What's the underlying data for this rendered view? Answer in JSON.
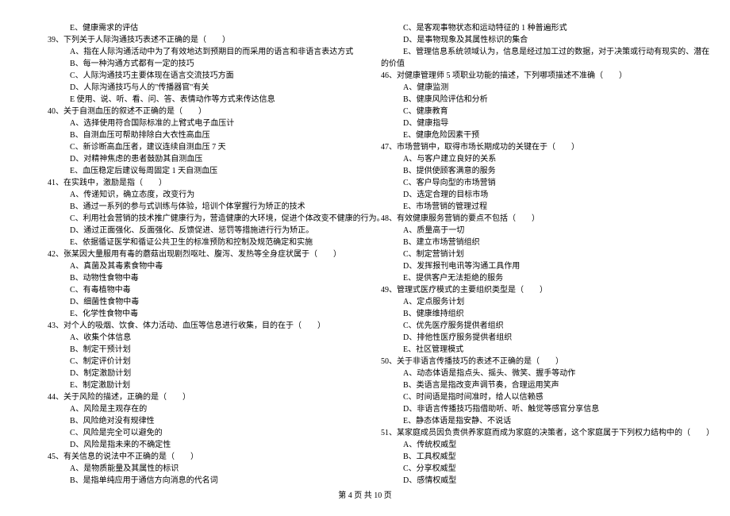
{
  "footer": "第 4 页 共 10 页",
  "left": {
    "pre_opt": "E、健康需求的评估",
    "q39": {
      "stem": "39、下列关于人际沟通技巧表述不正确的是（　　）",
      "A": "A、指在人际沟通活动中为了有效地达到预期目的而采用的语言和非语言表达方式",
      "B": "B、每一种沟通方式都有一定的技巧",
      "C": "C、人际沟通技巧主要体现在语言交流技巧方面",
      "D": "D、人际沟通技巧与人的\"传播器官\"有关",
      "E": "E 使用、说、听、看、问、答、表情动作等方式来传达信息"
    },
    "q40": {
      "stem": "40、关于自测血压的叙述不正确的是（　　）",
      "A": "A、选择使用符合国际标准的上臂式电子血压计",
      "B": "B、自测血压可帮助排除白大衣性高血压",
      "C": "C、新诊断高血压者，建议连续自测血压 7 天",
      "D": "D、对精神焦虑的患者鼓励其自测血压",
      "E": "E、血压稳定后建议每周固定 1 天自测血压"
    },
    "q41": {
      "stem": "41、在实践中，激励是指（　　）",
      "A": "A、传递知识，确立态度，改变行为",
      "B": "B、通过一系列的参与式训练与体验，培训个体掌握行为矫正的技术",
      "C": "C、利用社会营销的技术推广健康行为，营造健康的大环境，促进个体改变不健康的行为。",
      "D": "D、通过正面强化、反面强化、反馈促进、惩罚等措施进行行为矫正。",
      "E": "E、依据循证医学和循证公共卫生的标准预防和控制及规范确定和实施"
    },
    "q42": {
      "stem": "42、张某因大量服用有毒的蘑菇出现剧烈呕吐、腹泻、发热等全身症状属于（　　）",
      "A": "A、真菌及其毒素食物中毒",
      "B": "B、动物性食物中毒",
      "C": "C、有毒植物中毒",
      "D": "D、细菌性食物中毒",
      "E": "E、化学性食物中毒"
    },
    "q43": {
      "stem": "43、对个人的吸烟、饮食、体力活动、血压等信息进行收集，目的在于（　　）",
      "A": "A、收集个体信息",
      "B": "B、制定干预计划",
      "C": "C、制定评价计划",
      "D": "D、制定激励计划",
      "E": "E、制定激励计划"
    },
    "q44": {
      "stem": "44、关于风险的描述，正确的是（　　）",
      "A": "A、风险是主观存在的",
      "B": "B、风险绝对没有规律性",
      "C": "C、风险是完全可以避免的",
      "D": "D、风险是指未来的不确定性"
    },
    "q45": {
      "stem": "45、有关信息的说法中不正确的是（　　）",
      "A": "A、是物质能量及其属性的标识",
      "B": "B、是指单纯应用于通信方向消息的代名词"
    }
  },
  "right": {
    "q45cont": {
      "C": "C、是客观事物状态和运动特征的 1 种普遍形式",
      "D": "D、是事物现象及其属性标识的集合",
      "E": "E、管理信息系统领域认为，信息是经过加工过的数据，对于决策或行动有现实的、潜在",
      "Econt": "的价值"
    },
    "q46": {
      "stem": "46、对健康管理师 5 项职业功能的描述，下列哪项描述不准确（　　）",
      "A": "A、健康监测",
      "B": "B、健康风险评估和分析",
      "C": "C、健康教育",
      "D": "D、健康指导",
      "E": "E、健康危险因素干预"
    },
    "q47": {
      "stem": "47、市场营销中，取得市场长期成功的关键在于（　　）",
      "A": "A、与客户建立良好的关系",
      "B": "B、提供使顾客满意的服务",
      "C": "C、客户导向型的市场营销",
      "D": "D、选定合理的目标市场",
      "E": "E、市场营销的管理过程"
    },
    "q48": {
      "stem": "48、有效健康服务营销的要点不包括（　　）",
      "A": "A、质量高于一切",
      "B": "B、建立市场营销组织",
      "C": "C、制定营销计划",
      "D": "D、发挥报刊电讯等沟通工具作用",
      "E": "E、提供客户无法拒绝的服务"
    },
    "q49": {
      "stem": "49、管理式医疗模式的主要组织类型是（　　）",
      "A": "A、定点服务计划",
      "B": "B、健康维持组织",
      "C": "C、优先医疗服务提供者组织",
      "D": "D、排他性医疗服务提供者组织",
      "E": "E、社区管理模式"
    },
    "q50": {
      "stem": "50、关于非语言传播技巧的表述不正确的是（　　）",
      "A": "A、动态体语是指点头、摇头、微笑、握手等动作",
      "B": "B、类语言是指改变声调节奏，合理运用笑声",
      "C": "C、时间语是指时间准时，给人以信赖感",
      "D": "D、非语言传播技巧指借助听、听、触觉等感官分享信息",
      "E": "E、静态体语是指安静、不说话"
    },
    "q51": {
      "stem": "51、某家庭成员因负责供养家庭而成为家庭的决策者，这个家庭属于下列权力结构中的（　　）",
      "A": "A、传统权威型",
      "B": "B、工具权威型",
      "C": "C、分享权威型",
      "D": "D、感情权威型"
    }
  }
}
